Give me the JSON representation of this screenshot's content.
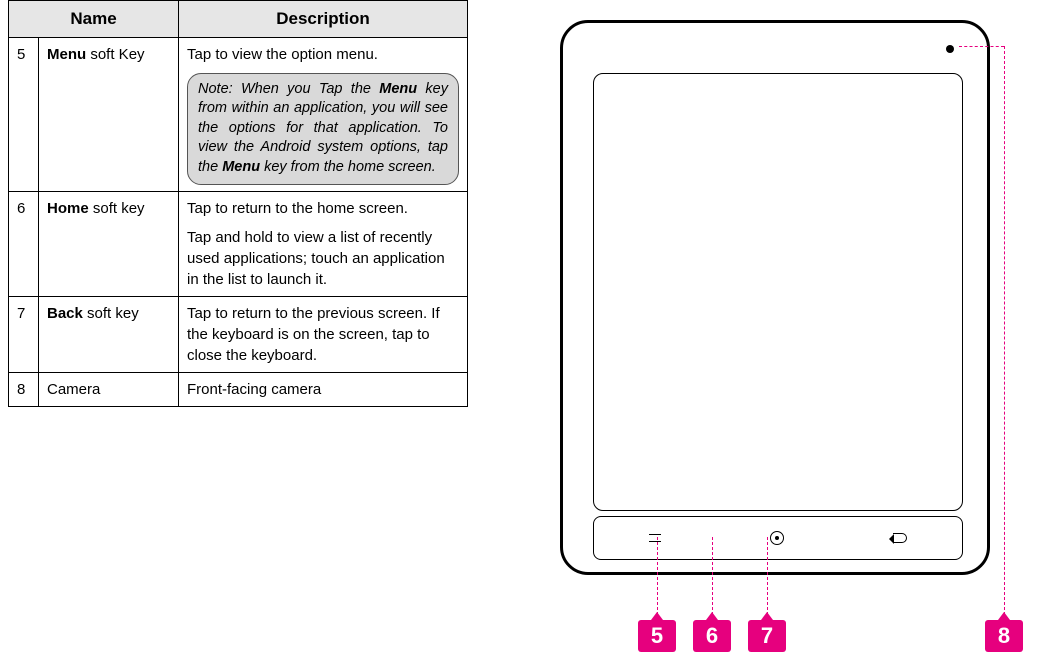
{
  "table": {
    "headers": {
      "name": "Name",
      "description": "Description"
    },
    "rows": [
      {
        "num": "5",
        "name_bold": "Menu",
        "name_rest": " soft Key",
        "desc": "Tap to view the option menu.",
        "note_prefix": "Note: When you Tap the ",
        "note_bold1": "Menu",
        "note_mid": " key from within an application, you will see the options for that application. To view the Android system options, tap the ",
        "note_bold2": "Menu",
        "note_suffix": " key from the home screen."
      },
      {
        "num": "6",
        "name_bold": "Home",
        "name_rest": " soft key",
        "desc_p1": "Tap to return to the home screen.",
        "desc_p2": "Tap and hold to view a list of recently used applications; touch an application in the list to launch it."
      },
      {
        "num": "7",
        "name_bold": "Back",
        "name_rest": " soft key",
        "desc": "Tap to return to the previous screen. If the keyboard is on the screen, tap to close the keyboard."
      },
      {
        "num": "8",
        "name": "Camera",
        "desc": "Front-facing camera"
      }
    ]
  },
  "callouts": {
    "c5": "5",
    "c6": "6",
    "c7": "7",
    "c8": "8"
  },
  "colors": {
    "accent": "#e6007e"
  }
}
